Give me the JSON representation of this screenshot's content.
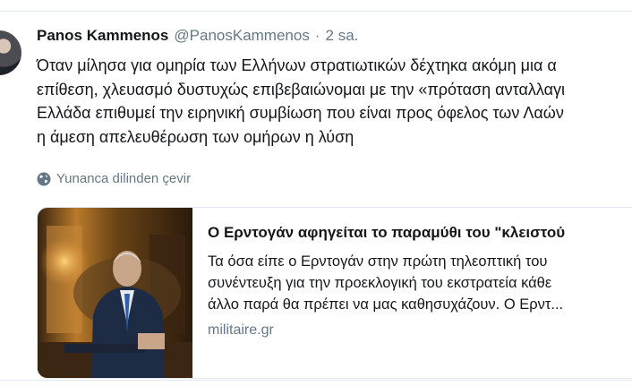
{
  "tweet": {
    "author_name": "Panos Kammenos",
    "author_handle": "@PanosKammenos",
    "separator": "·",
    "time": "2 sa.",
    "text_lines": [
      "Όταν μίλησα για ομηρία των Ελλήνων στρατιωτικών δέχτηκα ακόμη μια α",
      "επίθεση, χλευασμό δυστυχώς επιβεβαιώνομαι με την «πρόταση ανταλλαγι",
      "Ελλάδα επιθυμεί την ειρηνική συμβίωση που είναι προς όφελος των Λαών",
      "η άμεση απελευθέρωση των ομήρων η λύση"
    ],
    "translate_label": "Yunanca dilinden çevir",
    "translate_icon": "globe-icon"
  },
  "card": {
    "title": "Ο Ερντογάν αφηγείται το παραμύθι του \"κλειστού",
    "description_lines": [
      "Τα όσα είπε ο Ερντογάν στην πρώτη τηλεοπτική του",
      "συνέντευξη για την προεκλογική του εκστρατεία κάθε",
      "άλλο παρά θα πρέπει να μας καθησυχάζουν. Ο Ερντ..."
    ],
    "domain": "militaire.gr"
  },
  "colors": {
    "text": "#14171a",
    "secondary": "#657786",
    "border": "#e1e8ed"
  }
}
